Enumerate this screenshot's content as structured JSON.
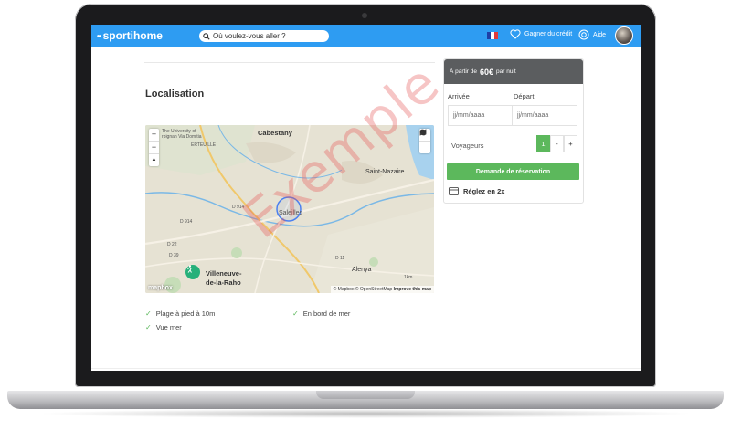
{
  "header": {
    "logo_text": "sportihome",
    "search_placeholder": "Où voulez-vous aller ?",
    "flag_colors": [
      "#1f3fa6",
      "#ffffff",
      "#e23b3b"
    ],
    "credit_label": "Gagner du crédit",
    "help_label": "Aide",
    "icons": [
      "search-icon",
      "heart-icon",
      "lifebuoy-icon",
      "avatar"
    ]
  },
  "main": {
    "section_title": "Localisation",
    "map": {
      "labels": {
        "cabestany": "Cabestany",
        "university": "The University of",
        "university2": "rpignan Via Domitia",
        "perteuille": "ERTEUILLE",
        "saint_nazaire": "Saint-Nazaire",
        "saleilles": "Saleilles",
        "alenya": "Alenya",
        "villeneuve": "Villeneuve-",
        "villeneuve2": "de-la-Raho",
        "road1": "D 914",
        "road2": "D 914",
        "road3": "D 22",
        "road4": "D 39",
        "road5": "D 11",
        "scale": "1km"
      },
      "zoom_in": "+",
      "zoom_out": "−",
      "compass": "▲",
      "attribution_main": "© Mapbox © OpenStreetMap",
      "attribution_link": "Improve this map",
      "mapbox_logo": "mapbox"
    },
    "features": [
      "Plage à pied à 10m",
      "En bord de mer",
      "Vue mer"
    ]
  },
  "booking": {
    "price_prefix": "À partir de",
    "price": "60€",
    "price_suffix": "par nuit",
    "arrival_label": "Arrivée",
    "departure_label": "Départ",
    "arrival_placeholder": "jj/mm/aaaa",
    "departure_placeholder": "jj/mm/aaaa",
    "guests_label": "Voyageurs",
    "guests_value": "1",
    "minus": "-",
    "plus": "+",
    "request_button": "Demande de réservation",
    "split_payment": "Réglez en 2x"
  },
  "watermark": "Exemple",
  "colors": {
    "header_blue": "#2e9cf2",
    "green": "#5cb85c",
    "dark_header": "#5b5d5f"
  }
}
